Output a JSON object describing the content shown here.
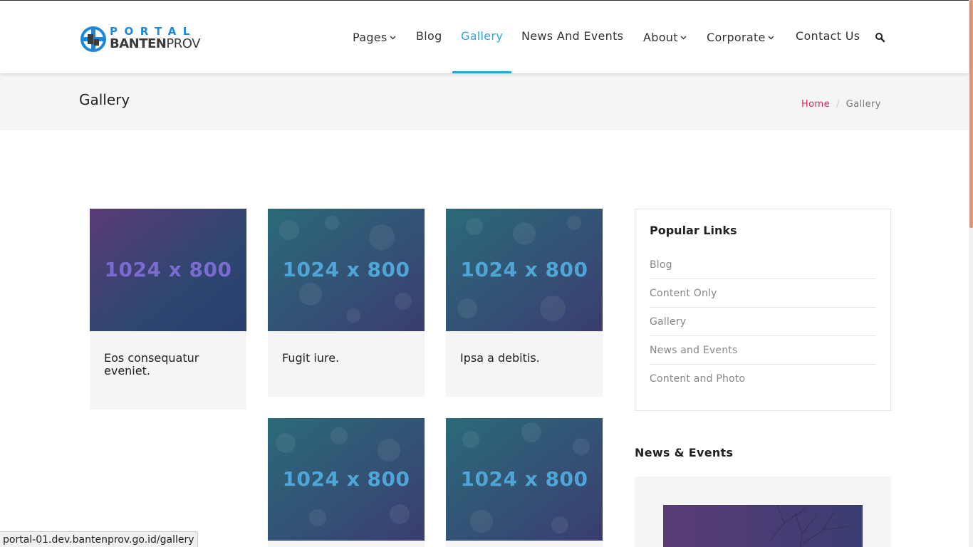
{
  "header": {
    "logo_top": "PORTAL",
    "logo_bottom_bold": "BANTEN",
    "logo_bottom_regular": "PROV",
    "nav": [
      {
        "label": "Pages",
        "has_dropdown": true
      },
      {
        "label": "Blog",
        "has_dropdown": false
      },
      {
        "label": "Gallery",
        "has_dropdown": false,
        "active": true
      },
      {
        "label": "News And Events",
        "has_dropdown": false
      },
      {
        "label": "About",
        "has_dropdown": true
      },
      {
        "label": "Corporate",
        "has_dropdown": true
      },
      {
        "label": "Contact Us",
        "has_dropdown": false
      }
    ],
    "search_icon": "search-icon",
    "active_color": "#2aa4e0"
  },
  "titlebar": {
    "title": "Gallery",
    "breadcrumb": {
      "home": "Home",
      "current": "Gallery"
    },
    "home_color": "#d0295a"
  },
  "gallery": {
    "placeholder_text": "1024 x 800",
    "cards": [
      {
        "caption": "Eos consequatur eveniet."
      },
      {
        "caption": "Fugit iure."
      },
      {
        "caption": "Ipsa a debitis."
      },
      {
        "caption": ""
      },
      {
        "caption": ""
      }
    ]
  },
  "sidebar": {
    "popular_title": "Popular Links",
    "popular_links": [
      "Blog",
      "Content Only",
      "Gallery",
      "News and Events",
      "Content and Photo"
    ],
    "news_title": "News & Events"
  },
  "statusbar": {
    "url": "portal-01.dev.bantenprov.go.id/gallery"
  }
}
